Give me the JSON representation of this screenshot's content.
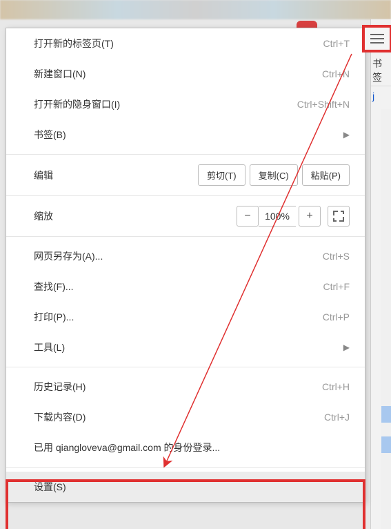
{
  "colors": {
    "accent_red": "#e03030",
    "shortcut_gray": "#999999"
  },
  "right_pane": {
    "bookmark_label": "书签",
    "link_fragment": "j"
  },
  "menu": {
    "new_tab": {
      "label": "打开新的标签页(T)",
      "shortcut": "Ctrl+T"
    },
    "new_window": {
      "label": "新建窗口(N)",
      "shortcut": "Ctrl+N"
    },
    "incognito": {
      "label": "打开新的隐身窗口(I)",
      "shortcut": "Ctrl+Shift+N"
    },
    "bookmarks": {
      "label": "书签(B)"
    },
    "edit": {
      "label": "编辑",
      "cut": "剪切(T)",
      "copy": "复制(C)",
      "paste": "粘贴(P)"
    },
    "zoom": {
      "label": "缩放",
      "minus": "−",
      "value": "100%",
      "plus": "+"
    },
    "save_as": {
      "label": "网页另存为(A)...",
      "shortcut": "Ctrl+S"
    },
    "find": {
      "label": "查找(F)...",
      "shortcut": "Ctrl+F"
    },
    "print": {
      "label": "打印(P)...",
      "shortcut": "Ctrl+P"
    },
    "tools": {
      "label": "工具(L)"
    },
    "history": {
      "label": "历史记录(H)",
      "shortcut": "Ctrl+H"
    },
    "downloads": {
      "label": "下载内容(D)",
      "shortcut": "Ctrl+J"
    },
    "signed_in": {
      "prefix": "已用 ",
      "email": "qiangloveva@gmail.com",
      "suffix": " 的身份登录..."
    },
    "settings": {
      "label": "设置(S)"
    }
  }
}
